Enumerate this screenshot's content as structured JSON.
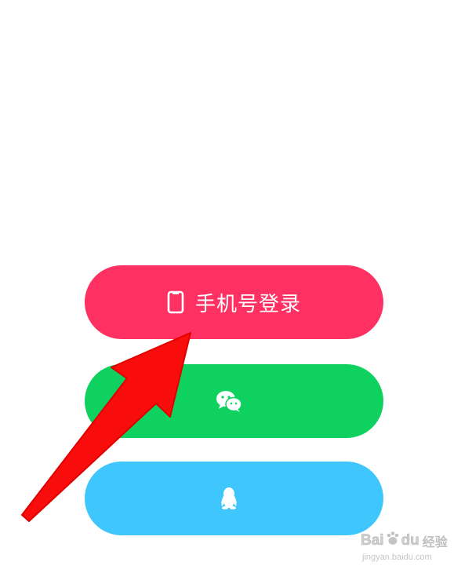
{
  "login": {
    "phone": {
      "label": "手机号登录",
      "icon": "phone-icon",
      "color": "#fe3162"
    },
    "wechat": {
      "label": "",
      "icon": "wechat-icon",
      "color": "#0ed160"
    },
    "qq": {
      "label": "",
      "icon": "qq-icon",
      "color": "#3ec6fd"
    }
  },
  "annotation": {
    "arrow_color": "#f80c0c",
    "icon": "red-arrow-icon"
  },
  "watermark": {
    "brand_left": "Bai",
    "brand_right": "du",
    "brand_cn": "经验",
    "url": "jingyan.baidu.com"
  }
}
